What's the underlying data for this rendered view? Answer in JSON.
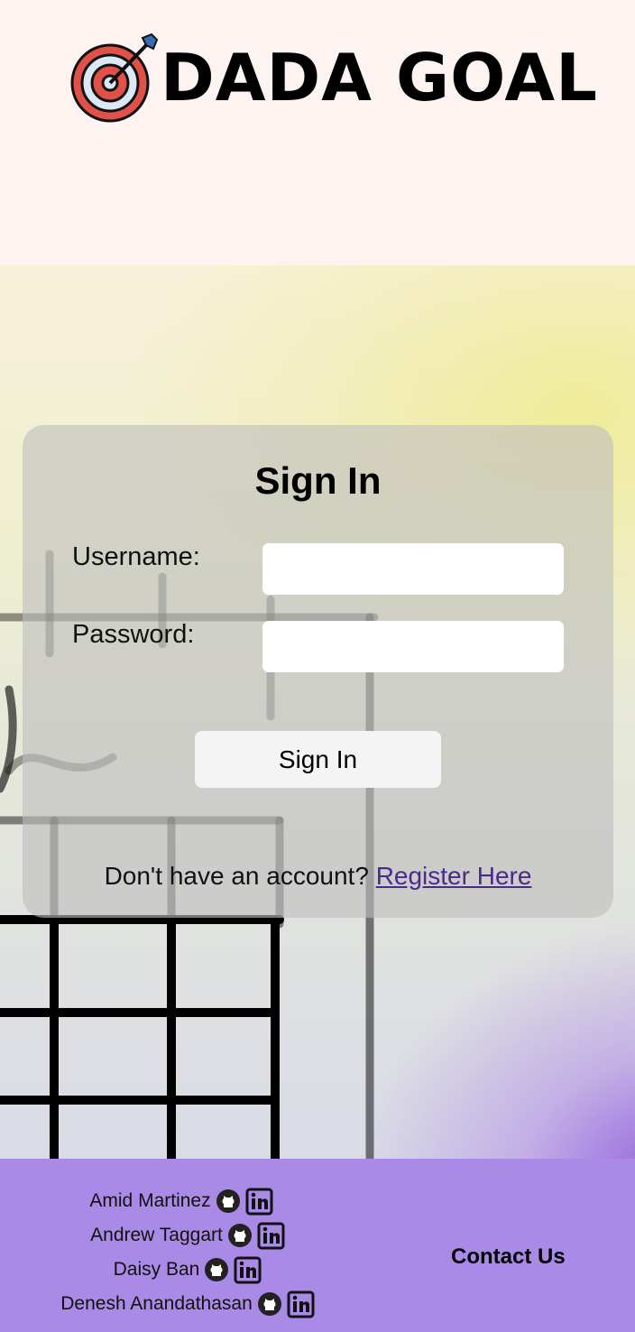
{
  "brand": {
    "name": "DADA GOAL",
    "icon": "target-arrow-icon"
  },
  "signin": {
    "title": "Sign In",
    "username_label": "Username:",
    "username_value": "",
    "password_label": "Password:",
    "password_value": "",
    "button_label": "Sign In",
    "register_prompt": "Don't have an account?",
    "register_link": "Register Here"
  },
  "footer": {
    "members": [
      {
        "name": "Amid Martinez"
      },
      {
        "name": "Andrew Taggart"
      },
      {
        "name": "Daisy Ban"
      },
      {
        "name": "Denesh Anandathasan"
      }
    ],
    "contact_label": "Contact Us"
  },
  "colors": {
    "header_bg": "#fdf4f1",
    "footer_bg": "#a98ae6",
    "link": "#4b2a8a",
    "target_red": "#e0514a",
    "target_light": "#dbe9f7"
  }
}
